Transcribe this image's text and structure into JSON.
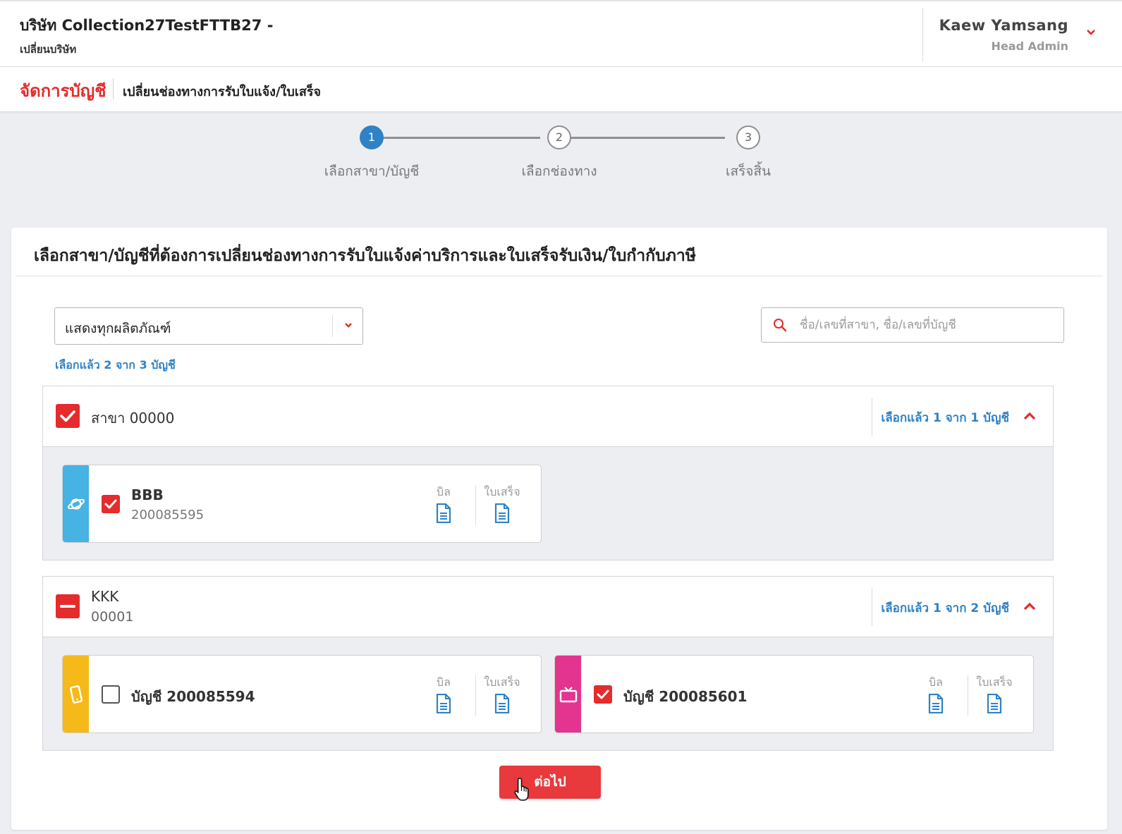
{
  "header": {
    "company": "บริษัท Collection27TestFTTB27 -",
    "change_company": "เปลี่ยนบริษัท",
    "user_name": "Kaew Yamsang",
    "user_role": "Head Admin"
  },
  "breadcrumb": {
    "section": "จัดการบัญชี",
    "page": "เปลี่ยนช่องทางการรับใบแจ้ง/ใบเสร็จ"
  },
  "stepper": {
    "steps": [
      {
        "number": "1",
        "label": "เลือกสาขา/บัญชี",
        "active": true
      },
      {
        "number": "2",
        "label": "เลือกช่องทาง",
        "active": false
      },
      {
        "number": "3",
        "label": "เสร็จสิ้น",
        "active": false
      }
    ]
  },
  "card": {
    "title": "เลือกสาขา/บัญชีที่ต้องการเปลี่ยนช่องทางการรับใบแจ้งค่าบริการและใบเสร็จรับเงิน/ใบกำกับภาษี",
    "product_filter": "แสดงทุกผลิตภัณฑ์",
    "search_placeholder": "ชื่อ/เลขที่สาขา, ชื่อ/เลขที่บัญชี",
    "selected_summary": "เลือกแล้ว 2 จาก 3 บัญชี"
  },
  "branches": [
    {
      "name": "สาขา 00000",
      "code": "",
      "check_state": "checked",
      "summary": "เลือกแล้ว 1 จาก 1 บัญชี",
      "accounts": [
        {
          "name": "BBB",
          "number": "200085595",
          "checked": true,
          "strip_color": "#47b2e4",
          "icon": "internet-icon",
          "bill_label": "บิล",
          "receipt_label": "ใบเสร็จ"
        }
      ]
    },
    {
      "name": "KKK",
      "code": "00001",
      "check_state": "partial",
      "summary": "เลือกแล้ว 1 จาก 2 บัญชี",
      "accounts": [
        {
          "name": "บัญชี 200085594",
          "number": "",
          "checked": false,
          "strip_color": "#f5b91a",
          "icon": "mobile-icon",
          "bill_label": "บิล",
          "receipt_label": "ใบเสร็จ"
        },
        {
          "name": "บัญชี 200085601",
          "number": "",
          "checked": true,
          "strip_color": "#e3348f",
          "icon": "tv-icon",
          "bill_label": "บิล",
          "receipt_label": "ใบเสร็จ"
        }
      ]
    }
  ],
  "actions": {
    "next_label": "ต่อไป"
  },
  "colors": {
    "accent_red": "#e52b2b",
    "accent_blue": "#2f82c6"
  }
}
